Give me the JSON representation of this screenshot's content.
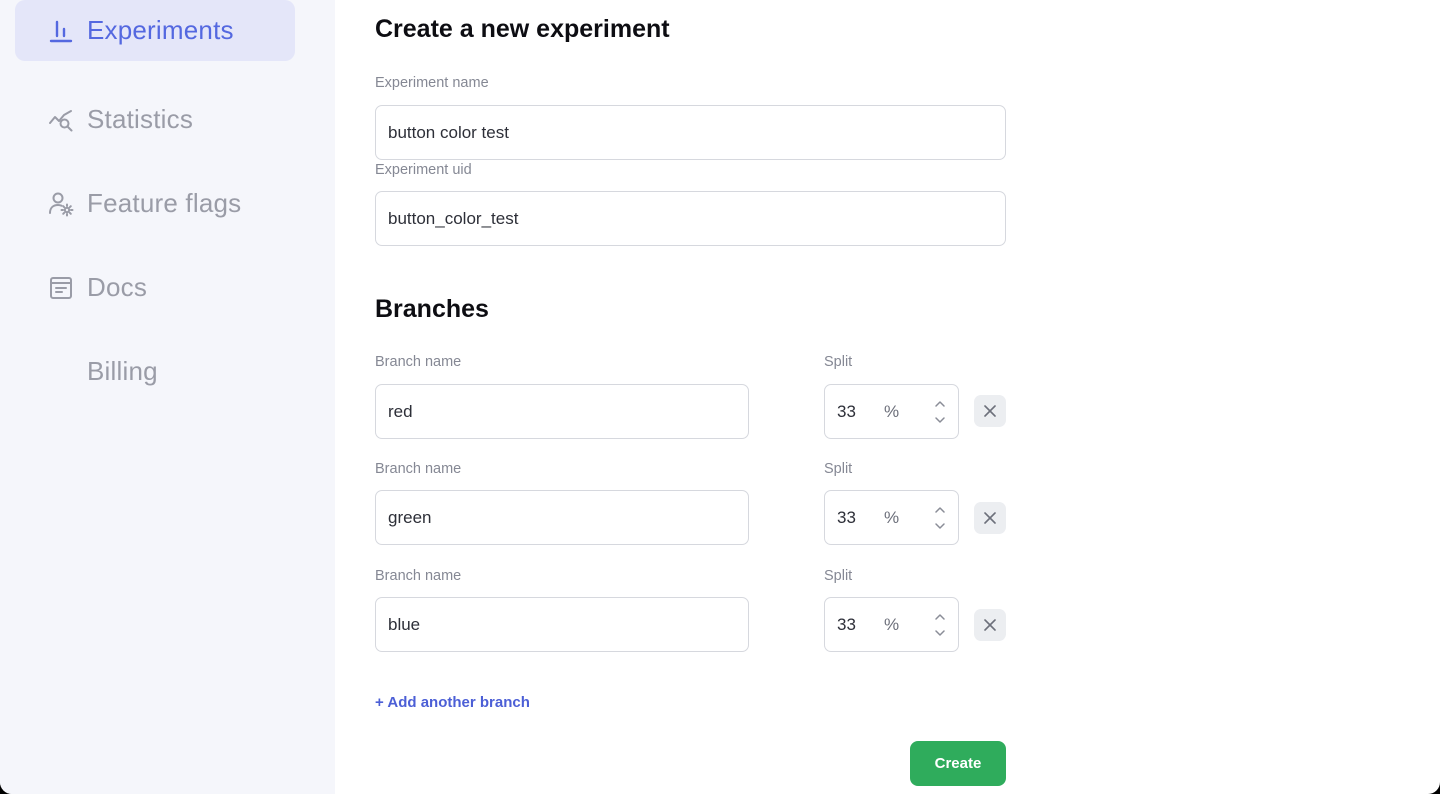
{
  "sidebar": {
    "items": [
      {
        "label": "Experiments",
        "icon": "bar-chart-icon",
        "active": true
      },
      {
        "label": "Statistics",
        "icon": "trend-search-icon",
        "active": false
      },
      {
        "label": "Feature flags",
        "icon": "user-gear-icon",
        "active": false
      },
      {
        "label": "Docs",
        "icon": "document-icon",
        "active": false
      },
      {
        "label": "Billing",
        "icon": "",
        "active": false
      }
    ]
  },
  "form": {
    "title": "Create a new experiment",
    "name_label": "Experiment name",
    "name_value": "button color test",
    "uid_label": "Experiment uid",
    "uid_value": "button_color_test"
  },
  "branches": {
    "title": "Branches",
    "name_label": "Branch name",
    "split_label": "Split",
    "unit": "%",
    "rows": [
      {
        "name": "red",
        "split": "33"
      },
      {
        "name": "green",
        "split": "33"
      },
      {
        "name": "blue",
        "split": "33"
      }
    ],
    "add_label": "+ Add another branch"
  },
  "actions": {
    "create_label": "Create"
  },
  "colors": {
    "accent": "#5468e0",
    "active_bg": "#e4e6f9",
    "sidebar_bg": "#f5f6fb",
    "create_button": "#2fac5c"
  }
}
